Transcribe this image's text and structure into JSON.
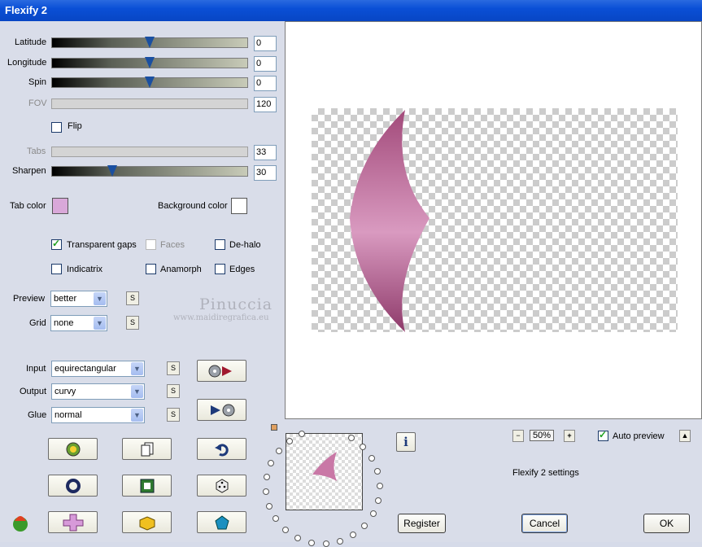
{
  "window": {
    "title": "Flexify 2"
  },
  "sliders": [
    {
      "label": "Latitude",
      "value": "0",
      "disabled": false,
      "thumb": 0.5
    },
    {
      "label": "Longitude",
      "value": "0",
      "disabled": false,
      "thumb": 0.5
    },
    {
      "label": "Spin",
      "value": "0",
      "disabled": false,
      "thumb": 0.5
    },
    {
      "label": "FOV",
      "value": "120",
      "disabled": true
    },
    {
      "label": "Tabs",
      "value": "33",
      "disabled": true
    },
    {
      "label": "Sharpen",
      "value": "30",
      "disabled": false,
      "thumb": 0.31
    }
  ],
  "flip": {
    "label": "Flip",
    "checked": false
  },
  "colors": {
    "tab_label": "Tab color",
    "tab_swatch": "#d9a8d9",
    "bg_label": "Background color",
    "bg_swatch": "#ffffff",
    "accent": "#0a4fd6",
    "shape": "#c978a6"
  },
  "options": {
    "transparent_gaps": {
      "label": "Transparent gaps",
      "checked": true
    },
    "faces": {
      "label": "Faces",
      "checked": false,
      "disabled": true
    },
    "dehalo": {
      "label": "De-halo",
      "checked": false
    },
    "indicatrix": {
      "label": "Indicatrix",
      "checked": false
    },
    "anamorph": {
      "label": "Anamorph",
      "checked": false
    },
    "edges": {
      "label": "Edges",
      "checked": false
    }
  },
  "preview_select": {
    "label": "Preview",
    "value": "better"
  },
  "grid_select": {
    "label": "Grid",
    "value": "none"
  },
  "input_select": {
    "label": "Input",
    "value": "equirectangular"
  },
  "output_select": {
    "label": "Output",
    "value": "curvy"
  },
  "glue_select": {
    "label": "Glue",
    "value": "normal"
  },
  "small_button_label": "S",
  "watermark": {
    "name": "Pinuccia",
    "url": "www.maidiregrafica.eu"
  },
  "zoom": {
    "minus": "−",
    "value": "50%",
    "plus": "+"
  },
  "auto_preview": {
    "label": "Auto preview",
    "checked": true
  },
  "settings_label": "Flexify 2 settings",
  "info_label": "i",
  "buttons": {
    "register": "Register",
    "cancel": "Cancel",
    "ok": "OK"
  },
  "icons": [
    "disc-forward-icon",
    "forward-disc-icon",
    "refresh-icon",
    "copy-icon",
    "undo-icon",
    "ring-icon",
    "square-icon",
    "dice-icon",
    "app-logo-icon",
    "cross-icon",
    "cube-icon",
    "pentagon-icon"
  ]
}
